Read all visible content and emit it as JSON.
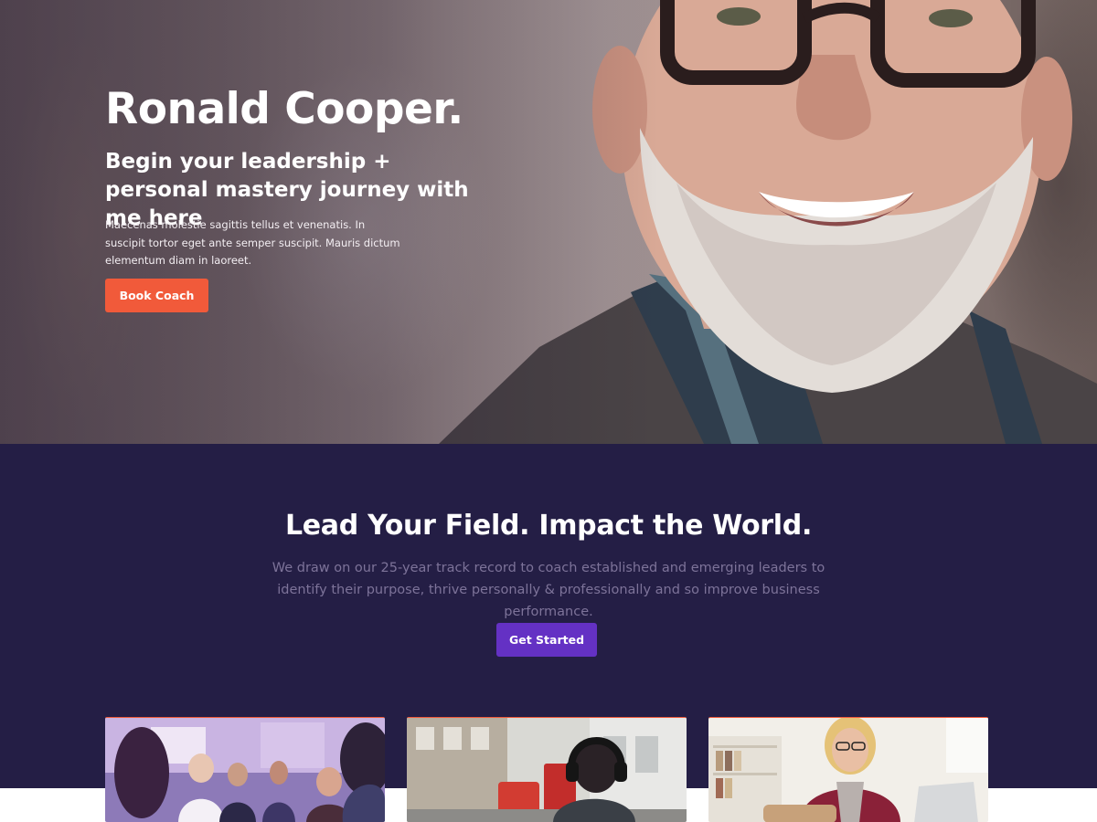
{
  "hero": {
    "title": "Ronald Cooper.",
    "subtitle": "Begin your leadership + personal mastery journey with me here",
    "body": "Maecenas molestie sagittis tellus et venenatis. In suscipit tortor eget ante semper suscipit. Mauris dictum elementum diam in laoreet.",
    "cta_label": "Book Coach"
  },
  "lead": {
    "title": "Lead Your Field. Impact the World.",
    "body": "We draw on our 25-year track record to coach established and emerging leaders to identify their purpose, thrive personally & professionally and so improve business performance.",
    "cta_label": "Get Started"
  },
  "cards": [
    {
      "image": "conference-audience-photo"
    },
    {
      "image": "city-street-headphones-photo"
    },
    {
      "image": "woman-laptop-photo"
    }
  ],
  "colors": {
    "hero_button": "#f15a3a",
    "section_bg": "#241e45",
    "start_button": "#6431c4",
    "body_muted": "#7d7399"
  }
}
